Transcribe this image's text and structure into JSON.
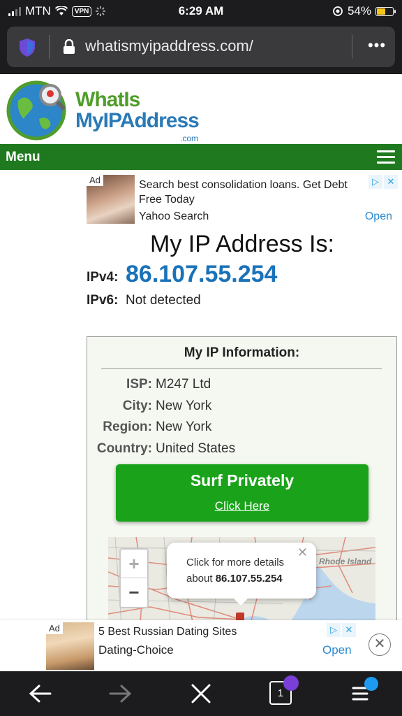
{
  "status_bar": {
    "carrier": "MTN",
    "vpn": "VPN",
    "time": "6:29 AM",
    "battery": "54%"
  },
  "browser": {
    "url": "whatismyipaddress.com/",
    "more_icon": "more-icon"
  },
  "site": {
    "logo_line1": "WhatIs",
    "logo_line2": "MyIPAddress",
    "logo_line3": ".com",
    "menu_label": "Menu"
  },
  "ad_top": {
    "tag": "Ad",
    "headline": "Search best consolidation loans. Get Debt Free Today",
    "source": "Yahoo Search",
    "open": "Open"
  },
  "ip": {
    "heading": "My IP Address Is:",
    "ipv4_label": "IPv4:",
    "ipv4_value": "86.107.55.254",
    "ipv6_label": "IPv6:",
    "ipv6_value": "Not detected"
  },
  "info": {
    "title": "My IP Information:",
    "rows": [
      {
        "key": "ISP:",
        "value": "M247 Ltd"
      },
      {
        "key": "City:",
        "value": "New York"
      },
      {
        "key": "Region:",
        "value": "New York"
      },
      {
        "key": "Country:",
        "value": "United States"
      }
    ],
    "surf_title": "Surf Privately",
    "surf_link": "Click Here"
  },
  "map": {
    "popup_line1": "Click for more details",
    "popup_line2_prefix": "about",
    "popup_line2_ip": "86.107.55.254",
    "label_ri": "Rhode Island",
    "zoom_in": "+",
    "zoom_out": "−"
  },
  "ad_bottom": {
    "tag": "Ad",
    "headline": "5 Best Russian Dating Sites",
    "source": "Dating-Choice",
    "open": "Open"
  },
  "toolbar": {
    "tab_count": "1"
  }
}
